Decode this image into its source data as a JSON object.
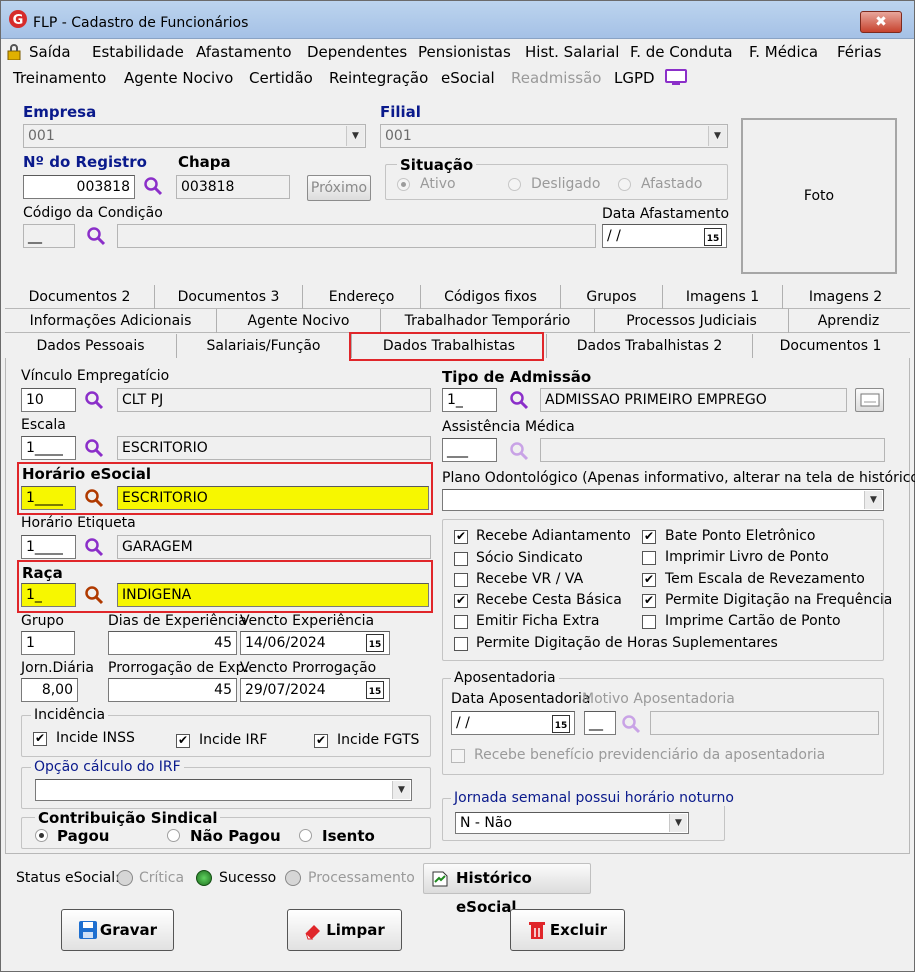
{
  "window": {
    "title": "FLP - Cadastro de Funcionários",
    "close_glyph": "✖"
  },
  "menu": {
    "row1": [
      "Saída",
      "Estabilidade",
      "Afastamento",
      "Dependentes",
      "Pensionistas",
      "Hist. Salarial",
      "F. de Conduta",
      "F. Médica",
      "Férias"
    ],
    "row2": [
      "Treinamento",
      "Agente Nocivo",
      "Certidão",
      "Reintegração",
      "eSocial",
      "Readmissão",
      "LGPD"
    ]
  },
  "header": {
    "empresa_label": "Empresa",
    "empresa_value": "001",
    "filial_label": "Filial",
    "filial_value": "001",
    "registro_label": "Nº do Registro",
    "registro_value": "003818",
    "chapa_label": "Chapa",
    "chapa_value": "003818",
    "proximo_label": "Próximo",
    "situacao_label": "Situação",
    "situacao_options": [
      "Ativo",
      "Desligado",
      "Afastado"
    ],
    "situacao_selected": "Ativo",
    "condicao_label": "Código da Condição",
    "condicao_value": "__",
    "data_afast_label": "Data Afastamento",
    "data_afast_value": "/ /",
    "foto_label": "Foto",
    "calendar_glyph": "15"
  },
  "tabs": {
    "row1": [
      "Documentos 2",
      "Documentos 3",
      "Endereço",
      "Códigos fixos",
      "Grupos",
      "Imagens 1",
      "Imagens 2"
    ],
    "row2": [
      "Informações Adicionais",
      "Agente Nocivo",
      "Trabalhador Temporário",
      "Processos Judiciais",
      "Aprendiz"
    ],
    "row3": [
      "Dados Pessoais",
      "Salariais/Função",
      "Dados Trabalhistas",
      "Dados Trabalhistas 2",
      "Documentos 1"
    ],
    "active": "Dados Trabalhistas"
  },
  "left": {
    "vinculo_label": "Vínculo Empregatício",
    "vinculo_code": "10",
    "vinculo_desc": "CLT PJ",
    "escala_label": "Escala",
    "escala_code": "1____",
    "escala_desc": "ESCRITORIO",
    "horario_label": "Horário eSocial",
    "horario_code": "1____",
    "horario_desc": "ESCRITORIO",
    "etiqueta_label": "Horário Etiqueta",
    "etiqueta_code": "1____",
    "etiqueta_desc": "GARAGEM",
    "raca_label": "Raça",
    "raca_code": "1_",
    "raca_desc": "INDIGENA",
    "grupo_label": "Grupo",
    "grupo_value": "1",
    "dias_exp_label": "Dias de Experiência",
    "dias_exp_value": "45",
    "vencto_exp_label": "Vencto Experiência",
    "vencto_exp_value": "14/06/2024",
    "jorn_label": "Jorn.Diária",
    "jorn_value": "8,00",
    "prorrog_label": "Prorrogação de Exp.",
    "prorrog_value": "45",
    "vencto_prorrog_label": "Vencto Prorrogação",
    "vencto_prorrog_value": "29/07/2024",
    "incidencia_label": "Incidência",
    "incide_inss": "Incide INSS",
    "incide_irf": "Incide IRF",
    "incide_fgts": "Incide FGTS",
    "opcao_irf_label": "Opção cálculo do IRF",
    "contrib_label": "Contribuição Sindical",
    "contrib_options": [
      "Pagou",
      "Não Pagou",
      "Isento"
    ],
    "contrib_selected": "Pagou"
  },
  "right": {
    "tipo_adm_label": "Tipo de Admissão",
    "tipo_adm_code": "1_",
    "tipo_adm_desc": "ADMISSAO PRIMEIRO EMPREGO",
    "assist_label": "Assistência Médica",
    "assist_code": "___",
    "odonto_label": "Plano Odontológico (Apenas informativo, alterar na tela de histórico)",
    "checks_left": [
      {
        "label": "Recebe Adiantamento",
        "checked": "✔"
      },
      {
        "label": "Sócio Sindicato",
        "checked": ""
      },
      {
        "label": "Recebe VR / VA",
        "checked": ""
      },
      {
        "label": "Recebe Cesta Básica",
        "checked": "✔"
      },
      {
        "label": "Emitir Ficha Extra",
        "checked": ""
      },
      {
        "label": "Permite Digitação de Horas Suplementares",
        "checked": ""
      }
    ],
    "checks_right": [
      {
        "label": "Bate Ponto Eletrônico",
        "checked": "✔"
      },
      {
        "label": "Imprimir Livro de Ponto",
        "checked": ""
      },
      {
        "label": "Tem Escala de Revezamento",
        "checked": "✔"
      },
      {
        "label": "Permite Digitação na Frequência",
        "checked": "✔"
      },
      {
        "label": "Imprime Cartão de Ponto",
        "checked": ""
      }
    ],
    "aposent_label": "Aposentadoria",
    "data_apos_label": "Data Aposentadoria",
    "data_apos_value": "/ /",
    "motivo_apos_label": "Motivo Aposentadoria",
    "motivo_apos_code": "__",
    "recebe_benef": "Recebe benefício previdenciário da aposentadoria",
    "jornada_label": "Jornada semanal possui horário noturno",
    "jornada_value": "N - Não"
  },
  "status": {
    "label": "Status eSocial:",
    "options": [
      "Crítica",
      "Sucesso",
      "Processamento"
    ],
    "selected": "Sucesso",
    "historico": "Histórico eSocial"
  },
  "buttons": {
    "gravar": "Gravar",
    "limpar": "Limpar",
    "excluir": "Excluir"
  },
  "colors": {
    "highlight": "#f7f700",
    "red_box": "#e0262a",
    "accent_purple": "#8b2fc9",
    "success_green": "#1f8a1f"
  }
}
